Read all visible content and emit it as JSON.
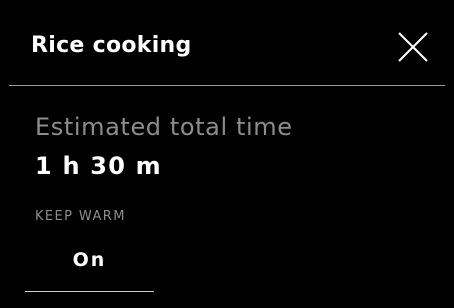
{
  "dialog": {
    "title": "Rice cooking",
    "close_icon": "close-icon"
  },
  "estimate": {
    "label": "Estimated total time",
    "value": "1 h 30 m"
  },
  "keep_warm": {
    "label": "KEEP WARM",
    "value": "On"
  },
  "colors": {
    "background": "#000000",
    "primary_text": "#ffffff",
    "secondary_text": "#8c8c8c",
    "divider": "#9a9a9a"
  }
}
